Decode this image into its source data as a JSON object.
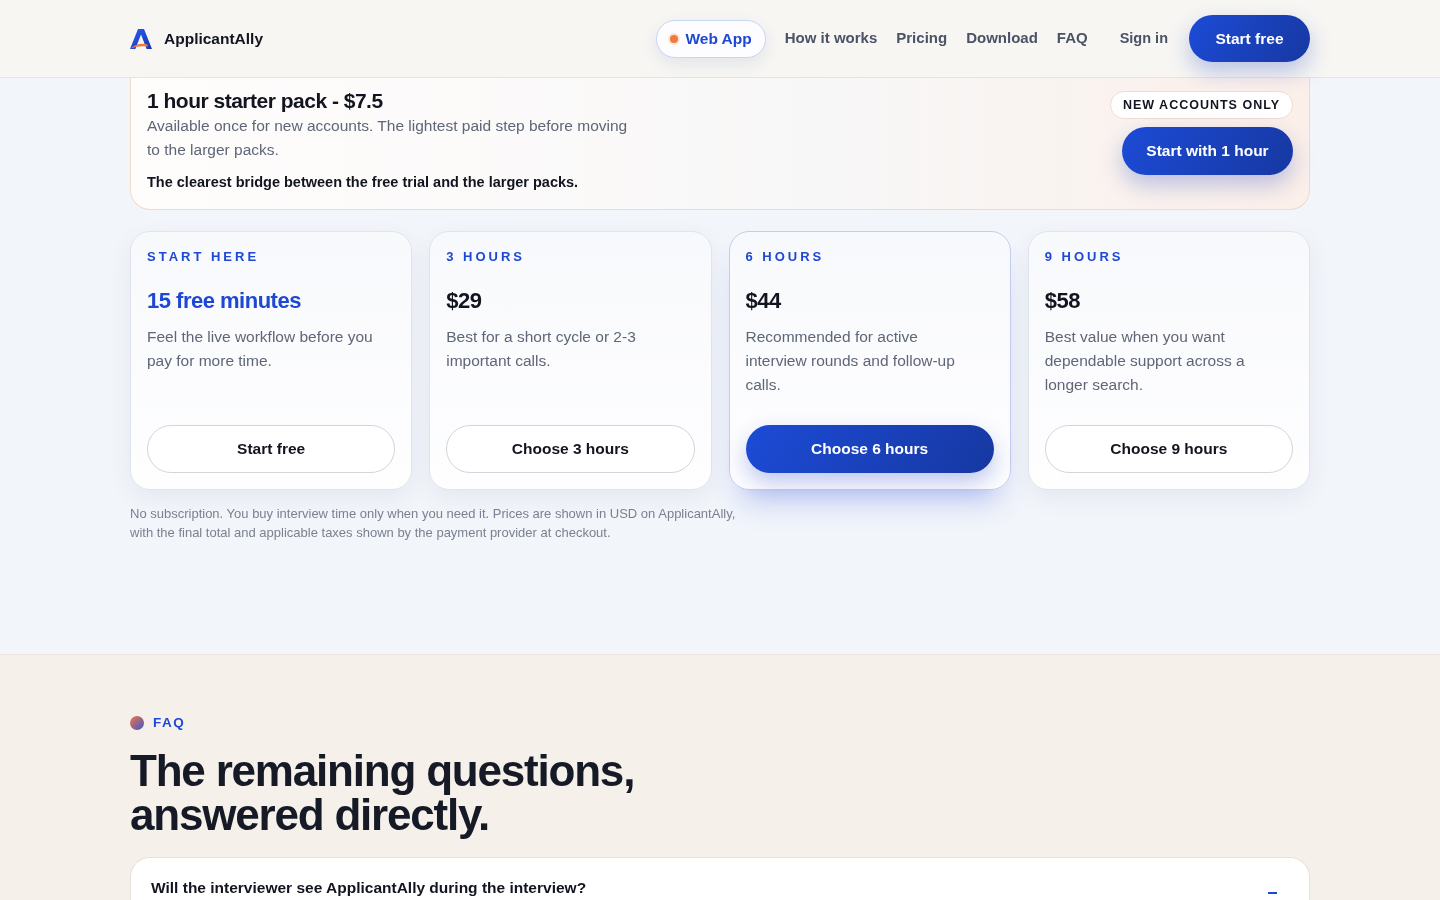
{
  "header": {
    "brand": "ApplicantAlly",
    "nav": [
      {
        "label": "Web App",
        "selected": true
      },
      {
        "label": "How it works",
        "selected": false
      },
      {
        "label": "Pricing",
        "selected": false
      },
      {
        "label": "Download",
        "selected": false
      },
      {
        "label": "FAQ",
        "selected": false
      }
    ],
    "sign_in": "Sign in",
    "cta": "Start free"
  },
  "starter_pack": {
    "title": "1 hour starter pack - $7.5",
    "description": "Available once for new accounts. The lightest paid step before moving to the larger packs.",
    "note": "The clearest bridge between the free trial and the larger packs.",
    "badge": "NEW ACCOUNTS ONLY",
    "button": "Start with 1 hour"
  },
  "plans": [
    {
      "label": "START HERE",
      "price": "15 free minutes",
      "kind": "free",
      "description": "Feel the live workflow before you pay for more time.",
      "button": "Start free",
      "featured": false
    },
    {
      "label": "3 HOURS",
      "price": "$29",
      "kind": "paid",
      "description": "Best for a short cycle or 2-3 important calls.",
      "button": "Choose 3 hours",
      "featured": false
    },
    {
      "label": "6 HOURS",
      "price": "$44",
      "kind": "paid",
      "description": "Recommended for active interview rounds and follow-up calls.",
      "button": "Choose 6 hours",
      "featured": true
    },
    {
      "label": "9 HOURS",
      "price": "$58",
      "kind": "paid",
      "description": "Best value when you want dependable support across a longer search.",
      "button": "Choose 9 hours",
      "featured": false
    }
  ],
  "footnote": "No subscription. You buy interview time only when you need it. Prices are shown in USD on ApplicantAlly, with the final total and applicable taxes shown by the payment provider at checkout.",
  "faq": {
    "eyebrow": "FAQ",
    "heading": "The remaining questions, answered directly.",
    "items": [
      {
        "question": "Will the interviewer see ApplicantAlly during the interview?",
        "expanded": true
      }
    ]
  }
}
